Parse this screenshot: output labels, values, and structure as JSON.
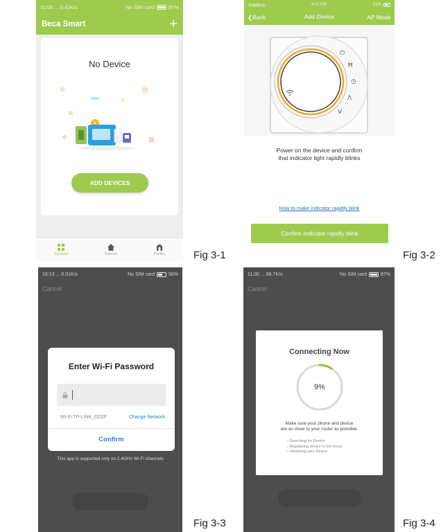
{
  "fig1": {
    "label": "Fig 3-1",
    "status": {
      "left": "11:00 ... 0.43K/s",
      "right": "No SIM card",
      "battery": "87%"
    },
    "app_title": "Beca Smart",
    "add_icon": "plus-icon",
    "empty_text": "No Device",
    "add_button": "ADD DEVICES",
    "tabs": [
      {
        "label": "Devices",
        "icon": "devices-grid-icon",
        "active": true
      },
      {
        "label": "Scenes",
        "icon": "home-icon",
        "active": false
      },
      {
        "label": "Profile",
        "icon": "profile-icon",
        "active": false
      }
    ],
    "accent": "#9ccb4e"
  },
  "fig2": {
    "label": "Fig 3-2",
    "status": {
      "left": "中国移动",
      "center": "4:17 PM",
      "right": "51%"
    },
    "back": "Back",
    "title": "Add Device",
    "mode": "AP Mode",
    "instruction_line1": "Power on the device and confirm",
    "instruction_line2": "that indicator light rapidly blinks",
    "help_link": "How to make indicator rapidly blink",
    "confirm_button": "Confirm indicator rapidly blink",
    "ring_color": "#f0a81e"
  },
  "fig3": {
    "label": "Fig 3-3",
    "status": {
      "left": "16:13 ... 0.01K/s",
      "right": "No SIM card",
      "battery": "56%"
    },
    "cancel": "Cancel",
    "dialog_title": "Enter Wi-Fi Password",
    "wifi_name": "Wi-Fi:TP-LINK_DD2F",
    "change_network": "Change Network",
    "confirm": "Confirm",
    "support_note": "This app is supported only on 2.4GHz Wi-Fi channels",
    "link_color": "#2f7bd8"
  },
  "fig4": {
    "label": "Fig 3-4",
    "status": {
      "left": "11:00 ... 98.7K/s",
      "right": "No SIM card",
      "battery": "87%"
    },
    "cancel": "Cancel",
    "dialog_title": "Connecting Now",
    "progress_text": "9%",
    "progress_value": 0.09,
    "note_line1": "Make sure your phone and device",
    "note_line2": "are as close to your router as possible.",
    "steps": [
      "Searching for Device",
      "Registering device to the cloud",
      "Initializing your Device"
    ]
  }
}
